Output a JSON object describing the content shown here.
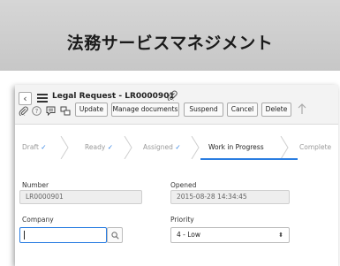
{
  "banner": {
    "title": "法務サービスマネジメント"
  },
  "header": {
    "back_icon": "chevron-left-icon",
    "menu_icon": "hamburger-menu-icon",
    "record_title": "Legal Request - LR0000901",
    "attachment_icon": "paperclip-icon"
  },
  "toolbar": {
    "icons": [
      "paperclip-icon",
      "help-icon",
      "comment-icon",
      "templates-icon"
    ],
    "buttons": [
      "Update",
      "Manage documents",
      "Suspend",
      "Cancel",
      "Delete"
    ],
    "more_icon": "arrow-up-icon"
  },
  "stages": [
    {
      "label": "Draft",
      "check": "✓",
      "state": "done"
    },
    {
      "label": "Ready",
      "check": "✓",
      "state": "done"
    },
    {
      "label": "Assigned",
      "check": "✓",
      "state": "done"
    },
    {
      "label": "Work in Progress",
      "check": "",
      "state": "active"
    },
    {
      "label": "Complete",
      "check": "",
      "state": "pending"
    }
  ],
  "form": {
    "number_label": "Number",
    "number_value": "LR0000901",
    "opened_label": "Opened",
    "opened_value": "2015-08-28 14:34:45",
    "company_label": "Company",
    "company_value": "",
    "company_lookup_icon": "search-icon",
    "priority_label": "Priority",
    "priority_value": "4 - Low"
  },
  "colors": {
    "accent": "#2a7de1",
    "banner_bg": "#cfcfcf",
    "toolbar_bg": "#f3f3f3"
  }
}
